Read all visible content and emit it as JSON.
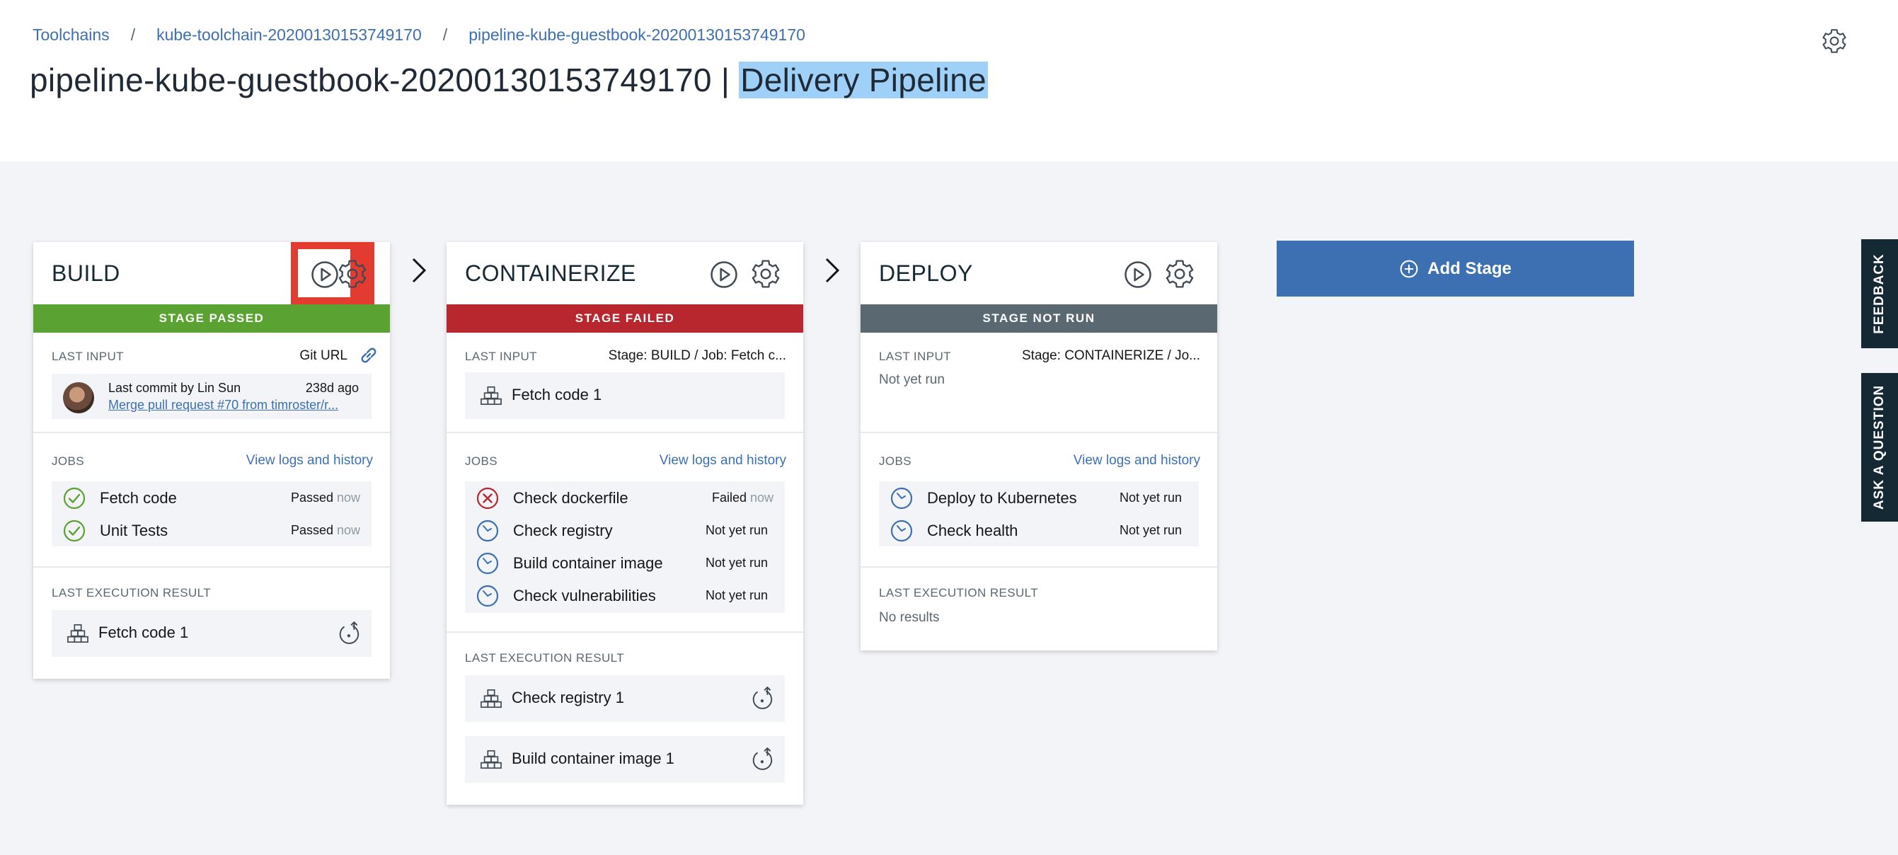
{
  "breadcrumb": [
    "Toolchains",
    "kube-toolchain-20200130153749170",
    "pipeline-kube-guestbook-20200130153749170"
  ],
  "breadcrumb_sep": "/",
  "title": {
    "main": "pipeline-kube-guestbook-20200130153749170 | ",
    "highlight": "Delivery Pipeline"
  },
  "icons": {
    "header": "gear-icon",
    "run": "play-icon",
    "configure": "gear-icon",
    "job_passed": "checkmark-circle-icon",
    "job_failed": "error-circle-icon",
    "job_pending": "clock-icon",
    "artifact": "stacked-boxes-icon",
    "redeploy": "redeploy-icon",
    "arrow": "chevron-right-icon",
    "add": "plus-circle-icon"
  },
  "colors": {
    "passed": "#5aa332",
    "failed": "#b8262e",
    "notrun": "#5a6872",
    "accent": "#3d70b2",
    "highlight": "#9fd0f8",
    "focus_frame": "#e33b2f"
  },
  "stages": {
    "build": {
      "name": "BUILD",
      "status": "STAGE PASSED",
      "last_input": {
        "label": "LAST INPUT",
        "source": "Git URL",
        "commit_by": "Last commit by Lin Sun",
        "age": "238d ago",
        "message": "Merge pull request #70 from timroster/r..."
      },
      "jobs": {
        "label": "JOBS",
        "link": "View logs and history",
        "items": [
          {
            "name": "Fetch code",
            "status": "Passed",
            "time": "now"
          },
          {
            "name": "Unit Tests",
            "status": "Passed",
            "time": "now"
          }
        ]
      },
      "results": {
        "label": "LAST EXECUTION RESULT",
        "items": [
          "Fetch code 1"
        ]
      }
    },
    "containerize": {
      "name": "CONTAINERIZE",
      "status": "STAGE FAILED",
      "last_input": {
        "label": "LAST INPUT",
        "source": "Stage: BUILD   /   Job: Fetch c...",
        "artifact": "Fetch code 1"
      },
      "jobs": {
        "label": "JOBS",
        "link": "View logs and history",
        "items": [
          {
            "name": "Check dockerfile",
            "status": "Failed",
            "time": "now"
          },
          {
            "name": "Check registry",
            "status": "Not yet run",
            "time": ""
          },
          {
            "name": "Build container image",
            "status": "Not yet run",
            "time": ""
          },
          {
            "name": "Check vulnerabilities",
            "status": "Not yet run",
            "time": ""
          }
        ]
      },
      "results": {
        "label": "LAST EXECUTION RESULT",
        "items": [
          "Check registry 1",
          "Build container image 1"
        ]
      }
    },
    "deploy": {
      "name": "DEPLOY",
      "status": "STAGE NOT RUN",
      "last_input": {
        "label": "LAST INPUT",
        "source": "Stage: CONTAINERIZE   /   Jo...",
        "note": "Not yet run"
      },
      "jobs": {
        "label": "JOBS",
        "link": "View logs and history",
        "items": [
          {
            "name": "Deploy to Kubernetes",
            "status": "Not yet run",
            "time": ""
          },
          {
            "name": "Check health",
            "status": "Not yet run",
            "time": ""
          }
        ]
      },
      "results": {
        "label": "LAST EXECUTION RESULT",
        "note": "No results"
      }
    }
  },
  "add_stage_label": "Add Stage",
  "side_tabs": {
    "feedback": "FEEDBACK",
    "ask": "ASK A QUESTION"
  }
}
